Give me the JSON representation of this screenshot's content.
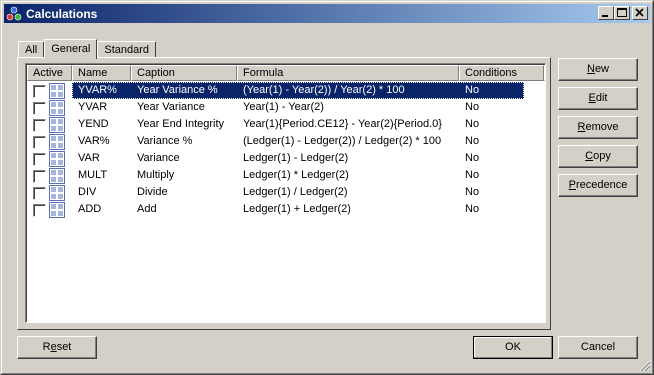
{
  "window": {
    "title": "Calculations"
  },
  "tabs": [
    {
      "label": "All"
    },
    {
      "label": "General"
    },
    {
      "label": "Standard"
    }
  ],
  "columns": [
    "Active",
    "Name",
    "Caption",
    "Formula",
    "Conditions"
  ],
  "rows": [
    {
      "name": "YVAR%",
      "caption": "Year Variance %",
      "formula": "(Year(1) - Year(2)) / Year(2) * 100",
      "conditions": "No",
      "selected": true
    },
    {
      "name": "YVAR",
      "caption": "Year Variance",
      "formula": "Year(1) - Year(2)",
      "conditions": "No"
    },
    {
      "name": "YEND",
      "caption": "Year End Integrity",
      "formula": "Year(1){Period.CE12} - Year(2){Period.0}",
      "conditions": "No"
    },
    {
      "name": "VAR%",
      "caption": "Variance %",
      "formula": "(Ledger(1) - Ledger(2)) / Ledger(2) * 100",
      "conditions": "No"
    },
    {
      "name": "VAR",
      "caption": "Variance",
      "formula": "Ledger(1) - Ledger(2)",
      "conditions": "No"
    },
    {
      "name": "MULT",
      "caption": "Multiply",
      "formula": "Ledger(1) * Ledger(2)",
      "conditions": "No"
    },
    {
      "name": "DIV",
      "caption": "Divide",
      "formula": "Ledger(1) / Ledger(2)",
      "conditions": "No"
    },
    {
      "name": "ADD",
      "caption": "Add",
      "formula": "Ledger(1) + Ledger(2)",
      "conditions": "No"
    }
  ],
  "side_buttons": {
    "new": {
      "mnemonic": "N",
      "rest": "ew"
    },
    "edit": {
      "mnemonic": "E",
      "rest": "dit"
    },
    "remove": {
      "mnemonic": "R",
      "rest": "emove"
    },
    "copy": {
      "mnemonic": "C",
      "rest": "opy"
    },
    "precedence": {
      "mnemonic": "P",
      "rest": "recedence"
    }
  },
  "bottom_buttons": {
    "reset": {
      "pre": "R",
      "mnemonic": "e",
      "rest": "set"
    },
    "ok": "OK",
    "cancel": "Cancel"
  },
  "colors": {
    "title_start": "#0a246a",
    "title_end": "#a6caf0",
    "selection": "#0a246a",
    "face": "#d4d0c8"
  }
}
